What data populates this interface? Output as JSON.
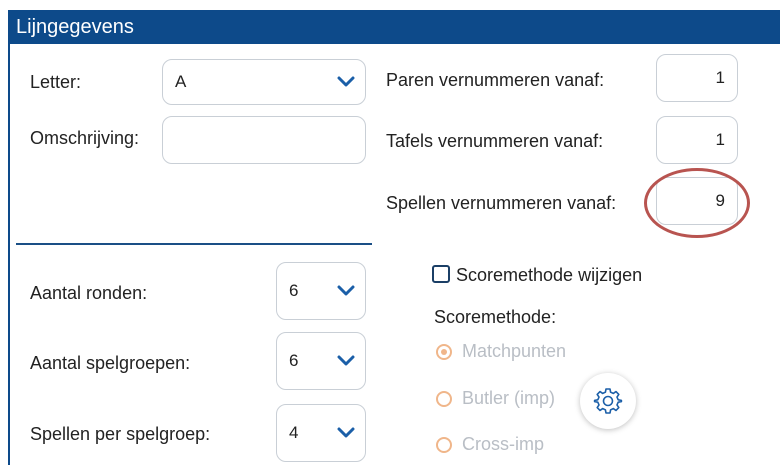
{
  "panel": {
    "title": "Lijngegevens"
  },
  "left_top": {
    "letter": {
      "label": "Letter:",
      "value": "A"
    },
    "omschrijving": {
      "label": "Omschrijving:",
      "value": ""
    }
  },
  "renumber": {
    "paren": {
      "label": "Paren vernummeren vanaf:",
      "value": "1"
    },
    "tafels": {
      "label": "Tafels vernummeren vanaf:",
      "value": "1"
    },
    "spellen": {
      "label": "Spellen vernummeren vanaf:",
      "value": "9"
    }
  },
  "left_bottom": {
    "aantal_ronden": {
      "label": "Aantal ronden:",
      "value": "6"
    },
    "aantal_spelgroepen": {
      "label": "Aantal spelgroepen:",
      "value": "6"
    },
    "spellen_per_spelgroep": {
      "label": "Spellen per spelgroep:",
      "value": "4"
    }
  },
  "scoring": {
    "change_label": "Scoremethode wijzigen",
    "change_checked": false,
    "heading": "Scoremethode:",
    "options": [
      {
        "label": "Matchpunten",
        "selected": true
      },
      {
        "label": "Butler (imp)",
        "selected": false
      },
      {
        "label": "Cross-imp",
        "selected": false
      }
    ]
  },
  "icons": {
    "chevron": "chevron-down-icon",
    "settings": "gear-icon"
  },
  "colors": {
    "header": "#0d4a8a",
    "highlight": "#b85450",
    "radio": "#f0b68a",
    "chevron": "#1b5fa8"
  }
}
